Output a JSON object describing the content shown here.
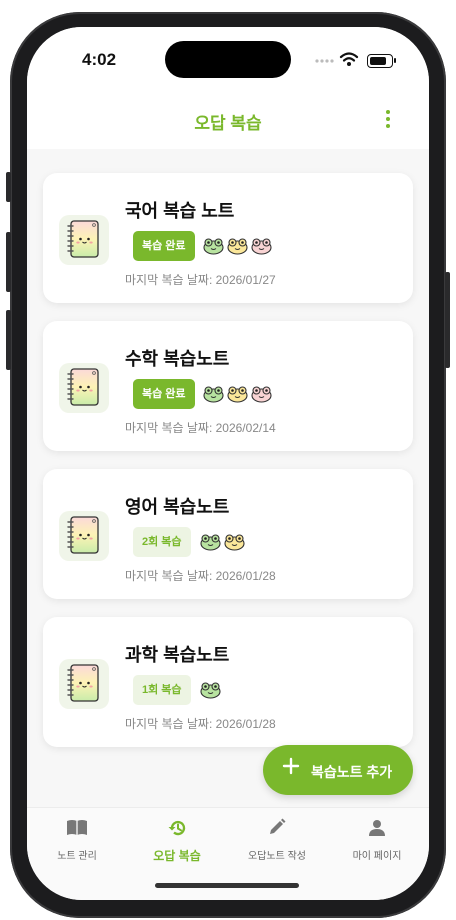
{
  "status_bar": {
    "time": "4:02"
  },
  "header": {
    "title": "오답 복습",
    "menu_icon": "more-vert-icon"
  },
  "notes": [
    {
      "title": "국어 복습 노트",
      "badge": "복습 완료",
      "badge_type": "done",
      "frogs": [
        "green",
        "yellow",
        "pink"
      ],
      "last_review": "마지막 복습 날짜: 2026/01/27"
    },
    {
      "title": "수학 복습노트",
      "badge": "복습 완료",
      "badge_type": "done",
      "frogs": [
        "green",
        "yellow",
        "pink"
      ],
      "last_review": "마지막 복습 날짜: 2026/02/14"
    },
    {
      "title": "영어 복습노트",
      "badge": "2회 복습",
      "badge_type": "count",
      "frogs": [
        "green",
        "yellow"
      ],
      "last_review": "마지막 복습 날짜: 2026/01/28"
    },
    {
      "title": "과학 복습노트",
      "badge": "1회 복습",
      "badge_type": "count",
      "frogs": [
        "green"
      ],
      "last_review": "마지막 복습 날짜: 2026/01/28"
    }
  ],
  "fab": {
    "label": "복습노트 추가",
    "icon": "plus-icon"
  },
  "tabs": [
    {
      "label": "노트 관리",
      "icon": "book-icon",
      "active": false
    },
    {
      "label": "오답 복습",
      "icon": "history-icon",
      "active": true
    },
    {
      "label": "오답노트 작성",
      "icon": "pencil-icon",
      "active": false
    },
    {
      "label": "마이 페이지",
      "icon": "person-icon",
      "active": false
    }
  ],
  "colors": {
    "accent": "#7ab82c",
    "badge_soft": "#edf4e3",
    "frog_green": "#b8e3a0",
    "frog_yellow": "#fbe79a",
    "frog_pink": "#f8d3d3"
  }
}
